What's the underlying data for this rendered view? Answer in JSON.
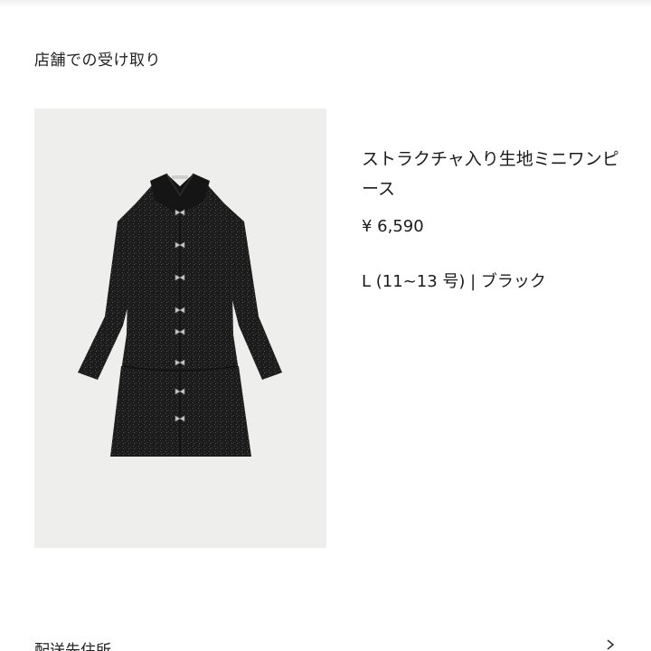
{
  "section": {
    "title": "店舗での受け取り"
  },
  "product": {
    "name": "ストラクチャ入り生地ミニワンピース",
    "price": "¥ 6,590",
    "variant": "L (11~13 号) | ブラック",
    "image_icon": "dress-photo"
  },
  "next_section": {
    "title": "配送先住所",
    "icon": "chevron-right-icon"
  },
  "colors": {
    "image_background": "#eeeeed",
    "garment": "#1d1d1d",
    "text": "#1b1b1b"
  }
}
